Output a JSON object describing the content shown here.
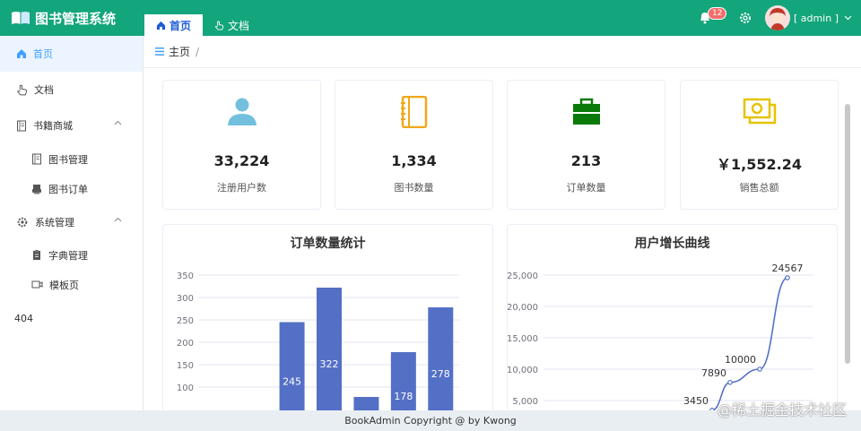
{
  "app": {
    "title": "图书管理系统"
  },
  "tabs": [
    {
      "label": "首页",
      "icon": "home-icon",
      "active": true
    },
    {
      "label": "文档",
      "icon": "hand-pointer-icon",
      "active": false
    }
  ],
  "header": {
    "notification_count": "12",
    "username": "[ admin ]"
  },
  "sidebar": {
    "items": [
      {
        "label": "首页",
        "icon": "home-icon",
        "active": true
      },
      {
        "label": "文档",
        "icon": "hand-pointer-icon"
      },
      {
        "label": "书籍商城",
        "icon": "document-icon",
        "expanded": true
      },
      {
        "label": "图书管理",
        "icon": "document-icon"
      },
      {
        "label": "图书订单",
        "icon": "printer-icon"
      },
      {
        "label": "系统管理",
        "icon": "gear-icon",
        "expanded": true
      },
      {
        "label": "字典管理",
        "icon": "clipboard-icon"
      },
      {
        "label": "模板页",
        "icon": "video-icon"
      },
      {
        "label": "404"
      }
    ]
  },
  "breadcrumb": {
    "label": "主页",
    "separator": "/"
  },
  "stats": [
    {
      "value": "33,224",
      "label": "注册用户数",
      "icon": "user-icon",
      "color": "#73c0de"
    },
    {
      "value": "1,334",
      "label": "图书数量",
      "icon": "notebook-icon",
      "color": "#f0a818"
    },
    {
      "value": "213",
      "label": "订单数量",
      "icon": "briefcase-icon",
      "color": "#0a7a0a"
    },
    {
      "value": "￥1,552.24",
      "label": "销售总额",
      "icon": "money-icon",
      "color": "#e6c200"
    }
  ],
  "chart_data": [
    {
      "type": "bar",
      "title": "订单数量统计",
      "yticks": [
        "350",
        "300",
        "250",
        "200",
        "150",
        "100"
      ],
      "values": [
        null,
        null,
        245,
        322,
        78,
        178,
        278
      ],
      "labels": [
        "",
        "",
        "245",
        "322",
        "",
        "178",
        "278"
      ],
      "ylim": [
        0,
        350
      ],
      "color": "#5470c6"
    },
    {
      "type": "line",
      "title": "用户增长曲线",
      "yticks": [
        "25,000",
        "20,000",
        "15,000",
        "10,000",
        "5,000"
      ],
      "values": [
        3450,
        7890,
        10000,
        24567
      ],
      "labels": [
        "3450",
        "7890",
        "10000",
        "24567"
      ],
      "ylim": [
        0,
        25000
      ],
      "color": "#5470c6"
    }
  ],
  "footer": {
    "text": "BookAdmin Copyright @ by Kwong"
  },
  "watermark": {
    "text": "@稀土掘金技术社区"
  }
}
